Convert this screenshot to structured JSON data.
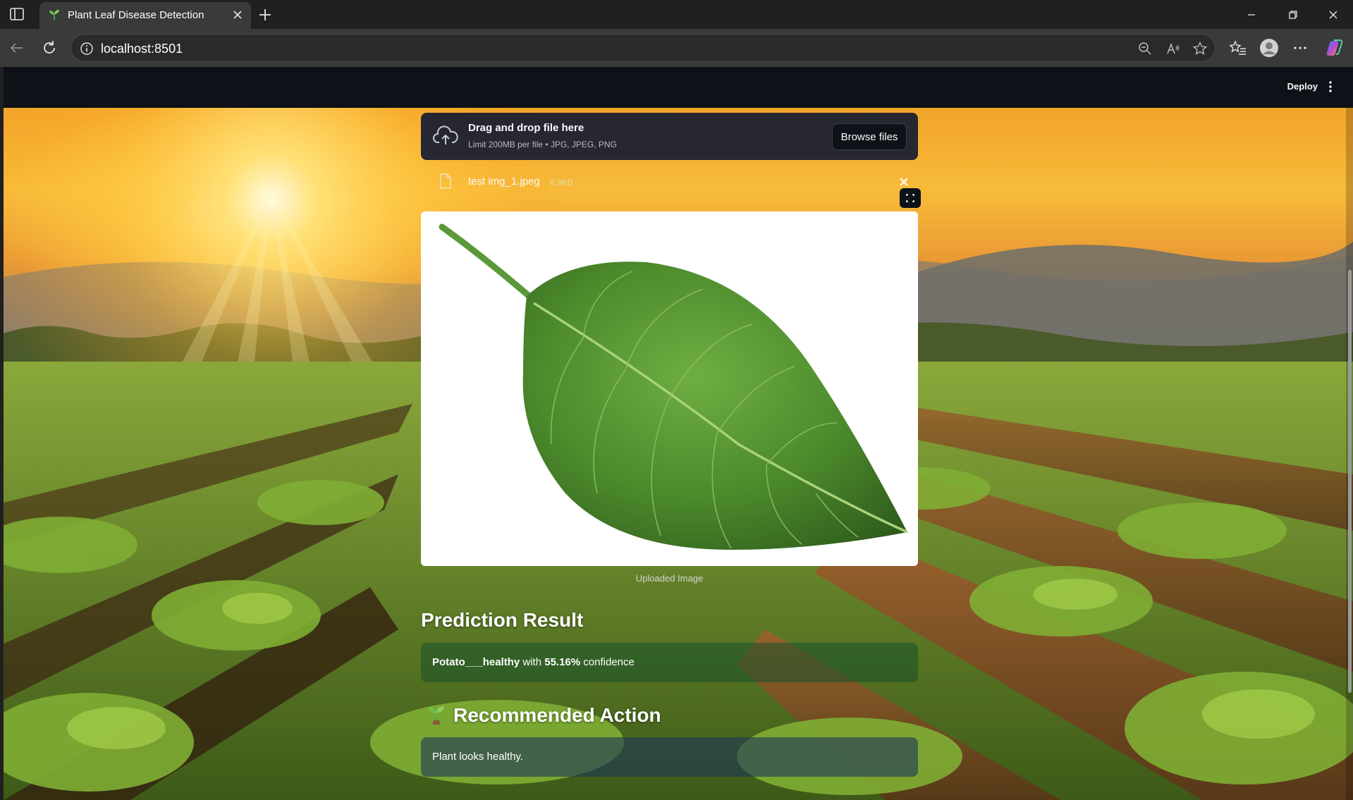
{
  "browser": {
    "tab_title": "Plant Leaf Disease Detection",
    "url": "localhost:8501"
  },
  "app": {
    "deploy_label": "Deploy"
  },
  "uploader": {
    "main_text": "Drag and drop file here",
    "sub_text": "Limit 200MB per file • JPG, JPEG, PNG",
    "browse_label": "Browse files"
  },
  "file": {
    "name": "test img_1.jpeg",
    "size": "6.9KB"
  },
  "image": {
    "caption": "Uploaded Image"
  },
  "prediction": {
    "heading": "Prediction Result",
    "label": "Potato___healthy",
    "mid": " with ",
    "confidence": "55.16%",
    "suffix": " confidence"
  },
  "recommendation": {
    "heading": "Recommended Action",
    "text": "Plant looks healthy."
  },
  "colors": {
    "header_bg": "#0e1117",
    "uploader_bg": "#262730",
    "success_bg": "#17502a",
    "info_bg": "#1c3658"
  }
}
